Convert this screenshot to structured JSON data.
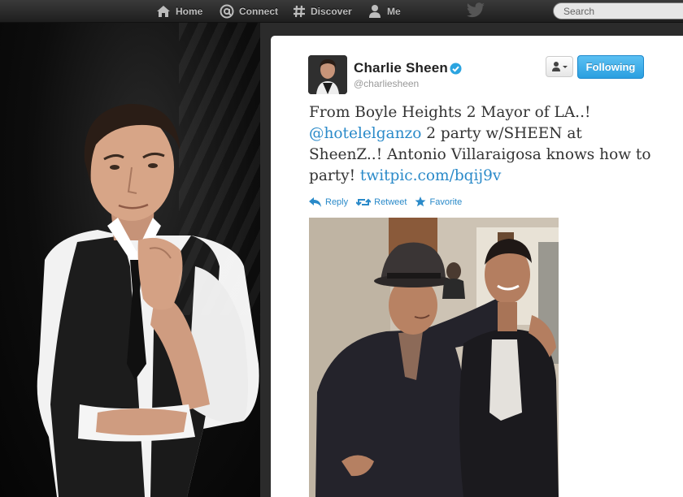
{
  "nav": {
    "home_label": "Home",
    "connect_label": "Connect",
    "discover_label": "Discover",
    "me_label": "Me",
    "search_placeholder": "Search",
    "icons": [
      "home-icon",
      "at-sign-icon",
      "hash-icon",
      "person-icon",
      "twitter-bird-icon"
    ]
  },
  "tweet": {
    "display_name": "Charlie Sheen",
    "screen_name": "@charliesheen",
    "verified": true,
    "follow_button": "Following",
    "text_before_mention": "From Boyle Heights 2 Mayor of LA..! ",
    "mention": "@hotelelganzo",
    "text_middle": " 2 party w/SHEEN at SheenZ..! Antonio Villaraigosa knows how to party! ",
    "link": "twitpic.com/bqij9v",
    "actions": {
      "reply": "Reply",
      "retweet": "Retweet",
      "favorite": "Favorite"
    }
  },
  "colors": {
    "link_blue": "#2a8ac9",
    "follow_button": "#2a9fe0",
    "verified_badge": "#2ba4e0",
    "topbar": "#2a2a2a"
  }
}
